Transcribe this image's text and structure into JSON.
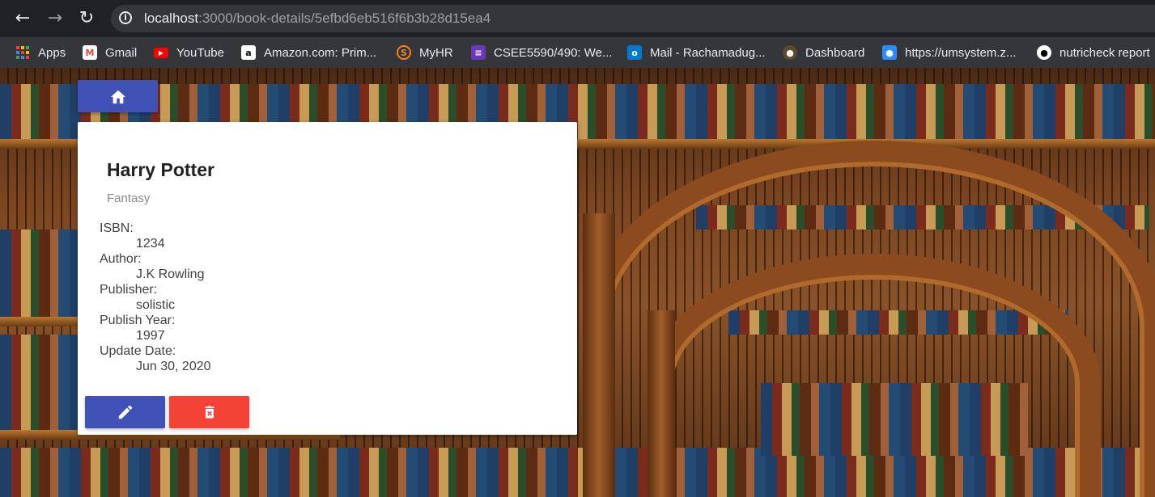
{
  "browser": {
    "url_host": "localhost",
    "url_path": ":3000/book-details/5efbd6eb516f6b3b28d15ea4",
    "back_icon": "arrow-left-icon",
    "forward_icon": "arrow-right-icon",
    "reload_icon": "reload-icon"
  },
  "bookmarks": [
    {
      "label": "Apps",
      "icon": "apps-grid-icon"
    },
    {
      "label": "Gmail",
      "icon": "gmail-icon"
    },
    {
      "label": "YouTube",
      "icon": "youtube-icon"
    },
    {
      "label": "Amazon.com: Prim...",
      "icon": "amazon-icon"
    },
    {
      "label": "MyHR",
      "icon": "myhr-icon"
    },
    {
      "label": "CSEE5590/490: We...",
      "icon": "course-icon"
    },
    {
      "label": "Mail - Rachamadug...",
      "icon": "outlook-icon"
    },
    {
      "label": "Dashboard",
      "icon": "dashboard-icon"
    },
    {
      "label": "https://umsystem.z...",
      "icon": "zoom-icon"
    },
    {
      "label": "nutricheck report",
      "icon": "github-icon"
    }
  ],
  "book": {
    "title": "Harry Potter",
    "genre": "Fantasy",
    "fields": [
      {
        "label": "ISBN:",
        "value": "1234"
      },
      {
        "label": "Author:",
        "value": "J.K Rowling"
      },
      {
        "label": "Publisher:",
        "value": "solistic"
      },
      {
        "label": "Publish Year:",
        "value": "1997"
      },
      {
        "label": "Update Date:",
        "value": "Jun 30, 2020"
      }
    ]
  },
  "colors": {
    "primary": "#3f51b5",
    "danger": "#f44336"
  }
}
